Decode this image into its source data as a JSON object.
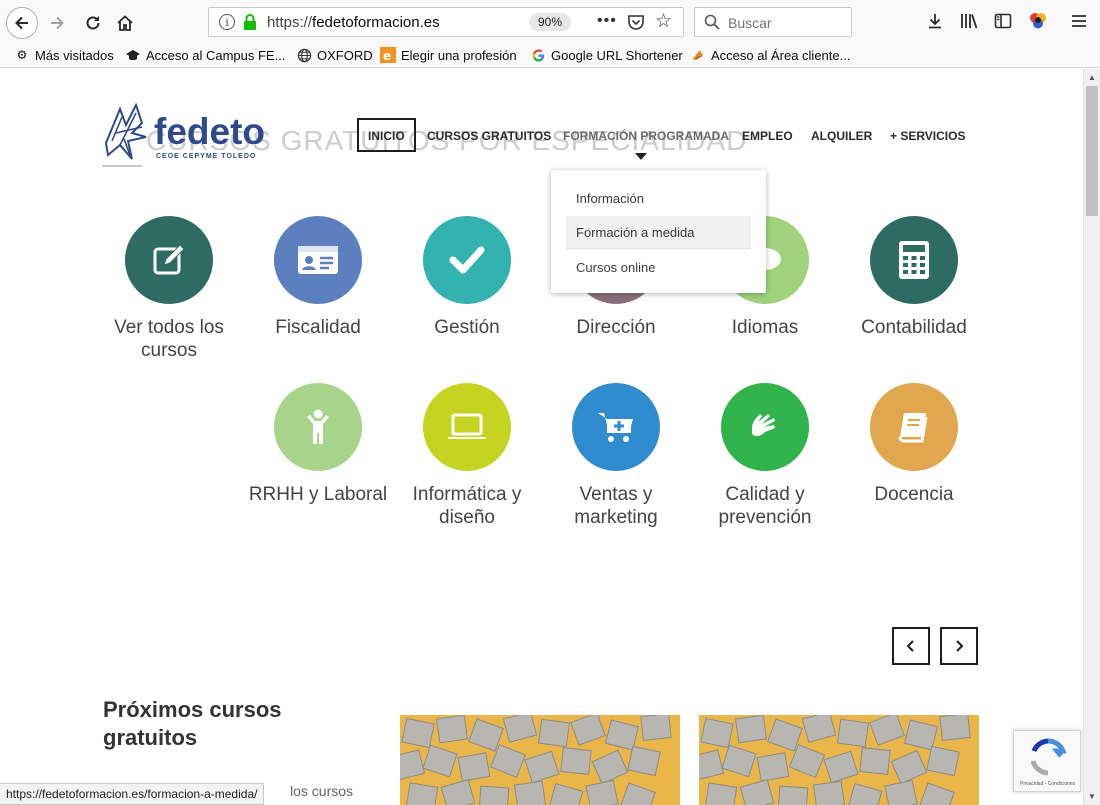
{
  "browser": {
    "url_prefix": "https://",
    "url_domain": "fedetoformacion.es",
    "zoom": "90%",
    "more": "•••",
    "search_placeholder": "Buscar",
    "bookmarks": [
      {
        "label": "Más visitados",
        "icon": "gear-icon"
      },
      {
        "label": "Acceso al Campus FE...",
        "icon": "graduation-cap-icon"
      },
      {
        "label": "OXFORD",
        "icon": "globe-icon"
      },
      {
        "label": "Elegir una profesión",
        "icon": "ie-icon"
      },
      {
        "label": "Google URL Shortener",
        "icon": "google-icon"
      },
      {
        "label": "Acceso al Área cliente...",
        "icon": "bird-icon"
      }
    ],
    "status_url": "https://fedetoformacion.es/formacion-a-medida/"
  },
  "site": {
    "logo_text": "fedeto",
    "logo_sub": "CEOE CEPYME TOLEDO",
    "ghost_heading": "CURSOS GRATUITOS POR ESPECIALIDAD",
    "nav": [
      {
        "label": "INICIO",
        "active": true
      },
      {
        "label": "CURSOS GRATUITOS"
      },
      {
        "label": "FORMACIÓN PROGRAMADA"
      },
      {
        "label": "EMPLEO"
      },
      {
        "label": "ALQUILER"
      },
      {
        "label": "+ SERVICIOS"
      }
    ],
    "dropdown": [
      {
        "label": "Información"
      },
      {
        "label": "Formación a medida",
        "hover": true
      },
      {
        "label": "Cursos online"
      }
    ],
    "categories": [
      {
        "label": "Ver todos los cursos",
        "color": "#2d6b63",
        "icon": "edit-icon"
      },
      {
        "label": "Fiscalidad",
        "color": "#5b7fbf",
        "icon": "id-card-icon"
      },
      {
        "label": "Gestión",
        "color": "#33b3b0",
        "icon": "check-icon"
      },
      {
        "label": "Dirección",
        "color": "#8a6f7a",
        "icon": "leader-icon"
      },
      {
        "label": "Idiomas",
        "color": "#9fd27b",
        "icon": "speech-icon"
      },
      {
        "label": "Contabilidad",
        "color": "#2d6b63",
        "icon": "calculator-icon"
      },
      {
        "label": "RRHH y Laboral",
        "color": "#a8d38a",
        "icon": "person-icon"
      },
      {
        "label": "Informática y diseño",
        "color": "#c4d421",
        "icon": "laptop-icon"
      },
      {
        "label": "Ventas y marketing",
        "color": "#2f8ccf",
        "icon": "cart-icon"
      },
      {
        "label": "Calidad y prevención",
        "color": "#2fb34a",
        "icon": "sign-language-icon"
      },
      {
        "label": "Docencia",
        "color": "#e0a74e",
        "icon": "book-icon"
      }
    ],
    "prev_label": "‹",
    "next_label": "›",
    "section_title": "Próximos cursos gratuitos",
    "section_sub": "los cursos",
    "recaptcha_text": "Privacidad - Condiciones"
  }
}
